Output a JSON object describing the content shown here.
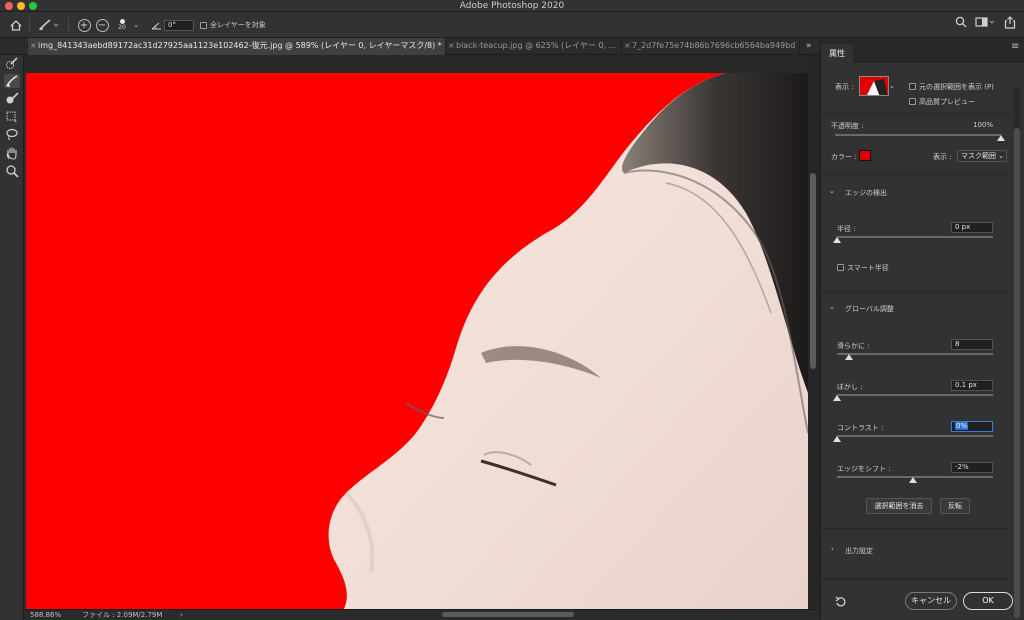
{
  "app": {
    "title": "Adobe Photoshop 2020"
  },
  "options_bar": {
    "brush_size": "20",
    "angle": "0°",
    "sample_all_layers_label": "全レイヤーを対象"
  },
  "tabs": [
    {
      "label": "img_841343aebd89172ac31d27925aa1123e102462-復元.jpg @ 589% (レイヤー 0, レイヤーマスク/8) *",
      "active": true
    },
    {
      "label": "black-teacup.jpg @ 625% (レイヤー 0, ...",
      "active": false
    },
    {
      "label": "7_2d7fe75e74b86b7696cb6564ba949bd",
      "active": false
    }
  ],
  "tab_overflow": "»",
  "status": {
    "zoom": "588.86%",
    "file": "ファイル : 2.09M/2.79M",
    "arrow": "›"
  },
  "panel": {
    "tab": "属性",
    "view_label": "表示 :",
    "show_original_label": "元の選択範囲を表示 (P)",
    "hq_preview_label": "高品質プレビュー",
    "opacity_label": "不透明度 :",
    "opacity_value": "100%",
    "color_label": "カラー :",
    "color_value": "#e00000",
    "display_label": "表示 :",
    "display_value": "マスク範囲",
    "edge_detection": {
      "title": "エッジの検出",
      "radius_label": "半径 :",
      "radius_value": "0 px",
      "smart_radius_label": "スマート半径"
    },
    "global": {
      "title": "グローバル調整",
      "smooth_label": "滑らかに :",
      "smooth_value": "8",
      "feather_label": "ぼかし :",
      "feather_value": "0.1 px",
      "contrast_label": "コントラスト :",
      "contrast_value": "0%",
      "shift_label": "エッジをシフト :",
      "shift_value": "-2%",
      "clear_selection_label": "選択範囲を消去",
      "invert_label": "反転"
    },
    "output_title": "出力設定",
    "cancel_label": "キャンセル",
    "ok_label": "OK"
  },
  "sliders": {
    "opacity": 1.0,
    "radius": 0.0,
    "smooth": 0.08,
    "feather": 0.0,
    "contrast": 0.0,
    "shift": 0.49
  }
}
